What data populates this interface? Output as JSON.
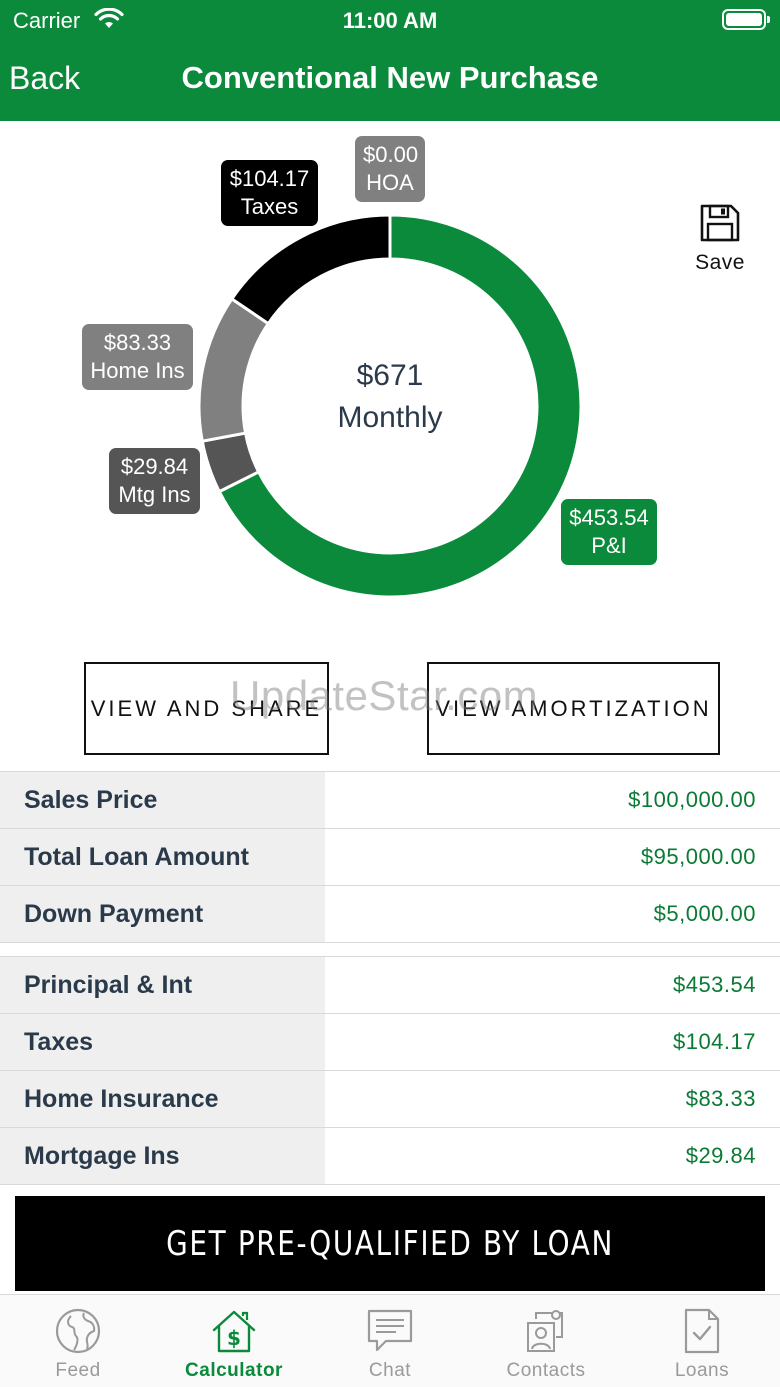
{
  "status_bar": {
    "carrier": "Carrier",
    "time": "11:00 AM"
  },
  "nav": {
    "back_label": "Back",
    "title": "Conventional New Purchase"
  },
  "save_label": "Save",
  "chart_data": {
    "type": "pie",
    "center": {
      "amount": "$671",
      "label": "Monthly"
    },
    "slices": [
      {
        "label": "P&I",
        "value": 453.54,
        "display": "$453.54",
        "color": "#0a8a3a"
      },
      {
        "label": "Mtg Ins",
        "value": 29.84,
        "display": "$29.84",
        "color": "#555555"
      },
      {
        "label": "Home Ins",
        "value": 83.33,
        "display": "$83.33",
        "color": "#808080"
      },
      {
        "label": "Taxes",
        "value": 104.17,
        "display": "$104.17",
        "color": "#000000"
      },
      {
        "label": "HOA",
        "value": 0.0,
        "display": "$0.00",
        "color": "#808080"
      }
    ]
  },
  "actions": {
    "view_share": "VIEW AND SHARE",
    "view_amortization": "VIEW AMORTIZATION"
  },
  "watermark": "UpdateStar.com",
  "loan_summary": [
    {
      "label": "Sales Price",
      "value": "$100,000.00"
    },
    {
      "label": "Total Loan Amount",
      "value": "$95,000.00"
    },
    {
      "label": "Down Payment",
      "value": "$5,000.00"
    }
  ],
  "payment_breakdown": [
    {
      "label": "Principal & Int",
      "value": "$453.54"
    },
    {
      "label": "Taxes",
      "value": "$104.17"
    },
    {
      "label": "Home Insurance",
      "value": "$83.33"
    },
    {
      "label": "Mortgage Ins",
      "value": "$29.84"
    }
  ],
  "cta_label": "GET PRE-QUALIFIED BY LOAN",
  "tabs": [
    {
      "label": "Feed",
      "icon": "globe-icon",
      "active": false
    },
    {
      "label": "Calculator",
      "icon": "house-dollar-icon",
      "active": true
    },
    {
      "label": "Chat",
      "icon": "chat-icon",
      "active": false
    },
    {
      "label": "Contacts",
      "icon": "contacts-icon",
      "active": false
    },
    {
      "label": "Loans",
      "icon": "document-check-icon",
      "active": false
    }
  ],
  "colors": {
    "brand": "#0a8a3a",
    "value_text": "#0a7a35",
    "label_bg": "#efefef"
  }
}
